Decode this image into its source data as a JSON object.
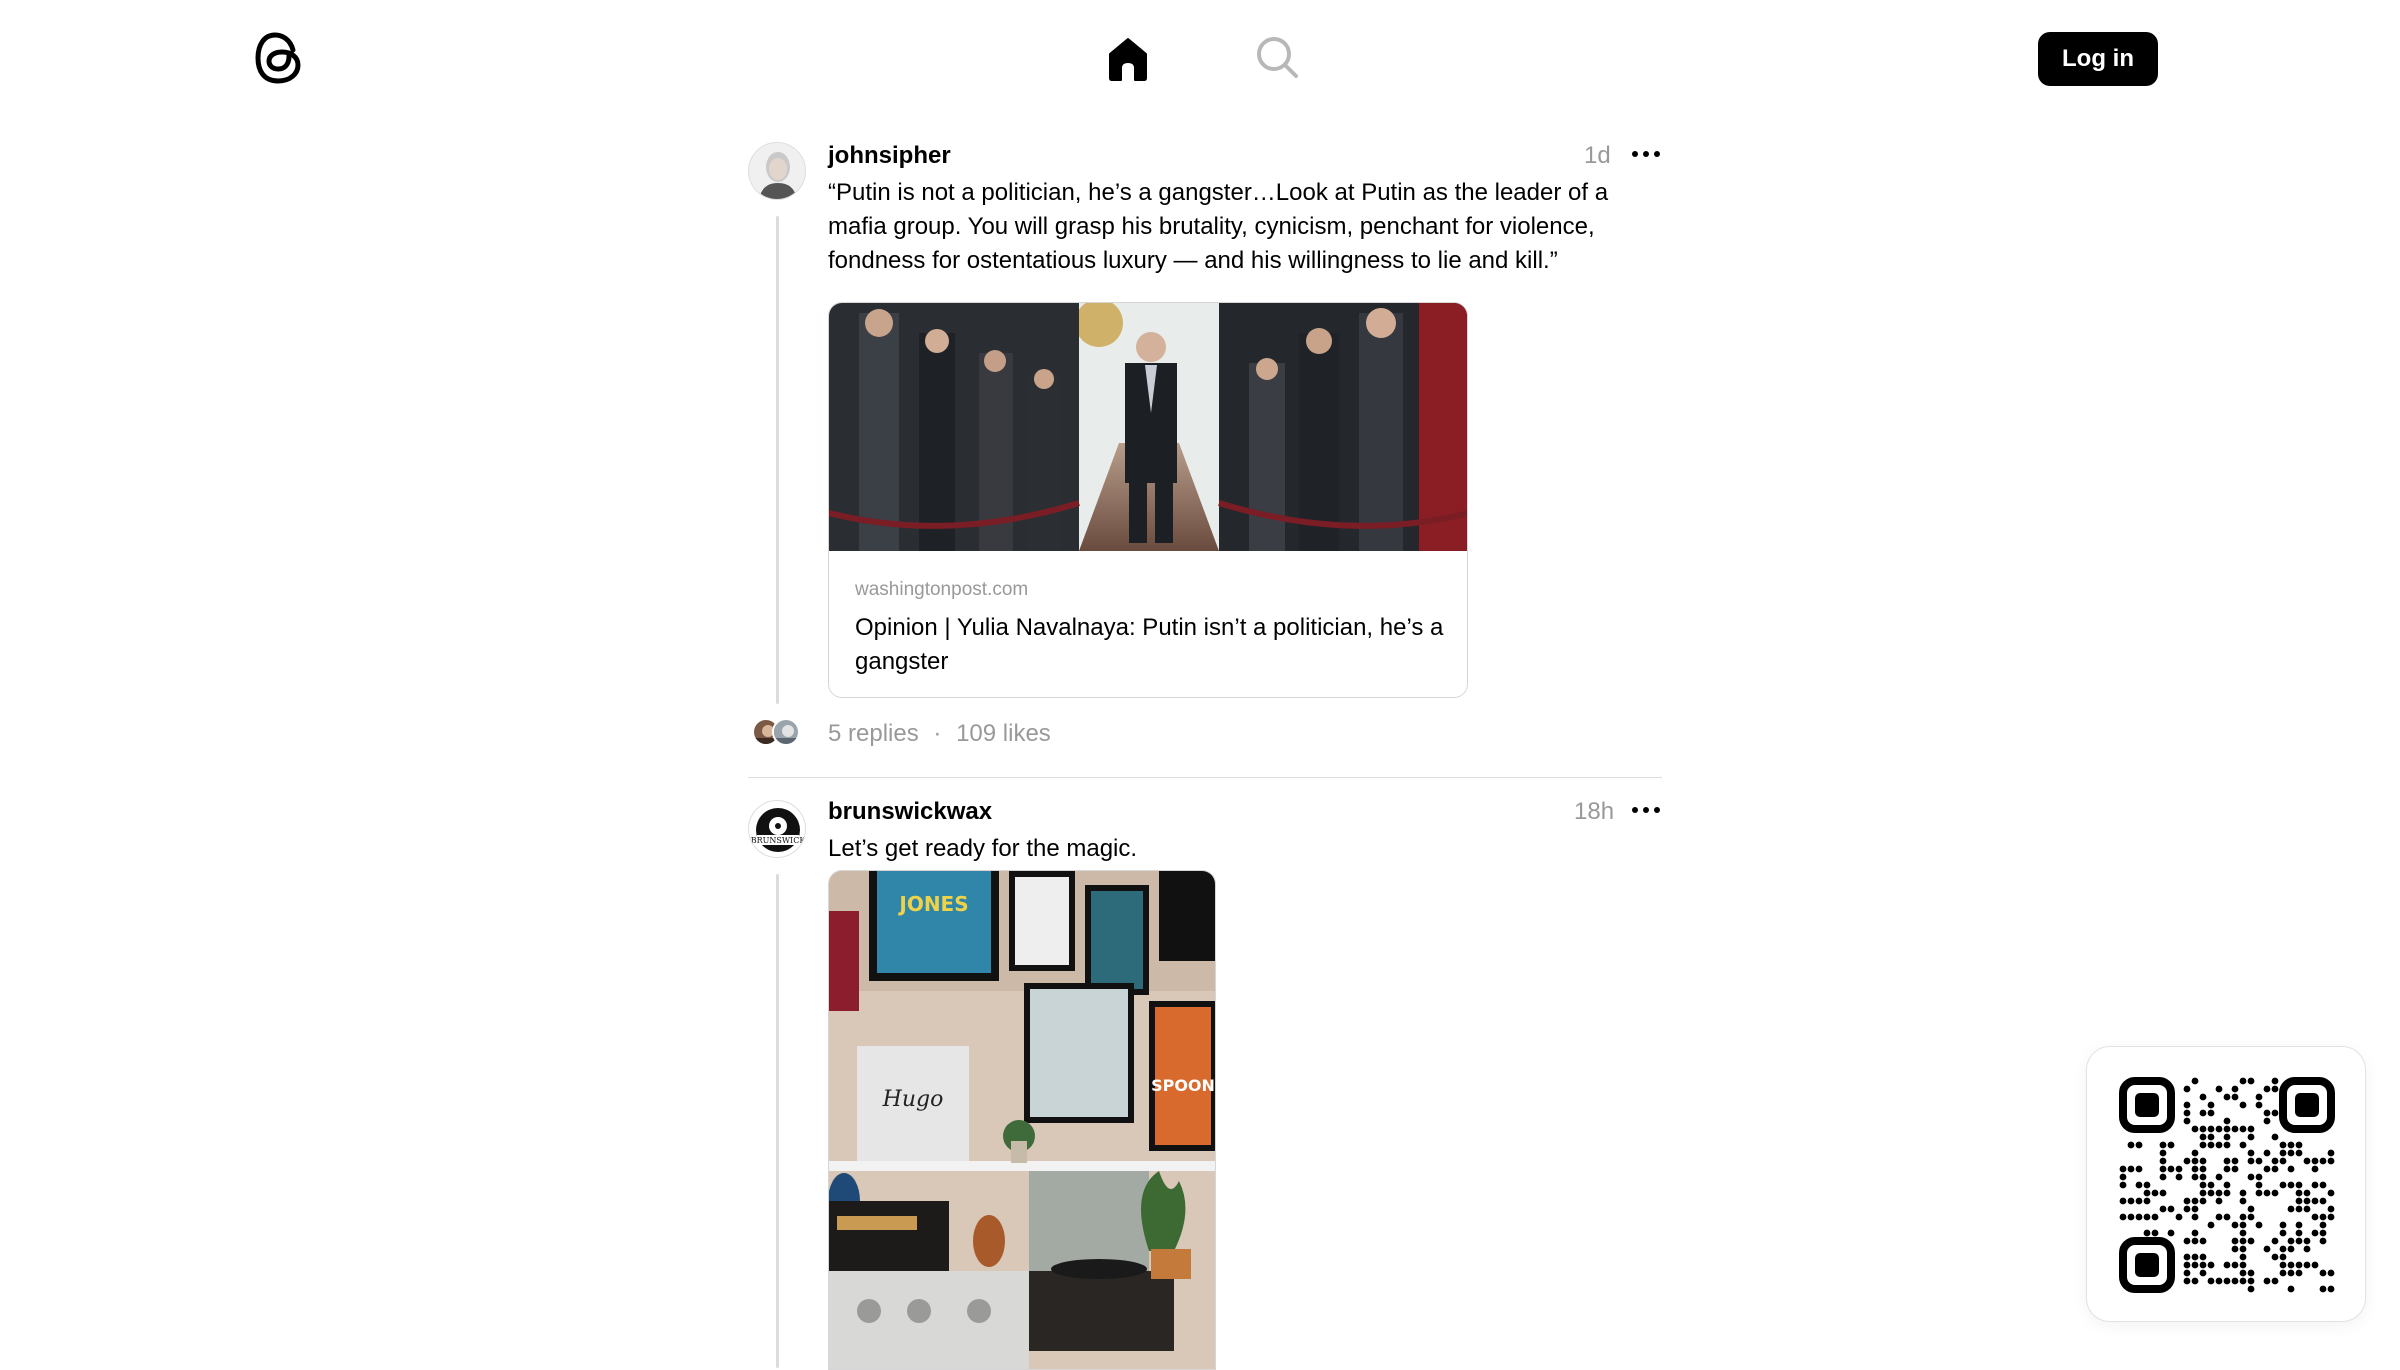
{
  "header": {
    "logo_icon": "threads-logo-icon",
    "home_icon": "home-icon",
    "search_icon": "search-icon",
    "login_label": "Log in"
  },
  "posts": [
    {
      "username": "johnsipher",
      "time": "1d",
      "text": "“Putin is not a politician, he’s a gangster…Look at Putin as the leader of a mafia group. You will grasp his brutality, cynicism, penchant for violence, fondness for ostentatious luxury — and his willingness to lie and kill.”",
      "link": {
        "domain": "washingtonpost.com",
        "title": "Opinion | Yulia Navalnaya: Putin isn’t a politician, he’s a gangster"
      },
      "replies": "5 replies",
      "separator": "·",
      "likes": "109 likes"
    },
    {
      "username": "brunswickwax",
      "time": "18h",
      "text": "Let’s get ready for the magic."
    }
  ],
  "colors": {
    "accent": "#000000",
    "muted_text": "#999999",
    "divider": "#dcdcdc"
  }
}
